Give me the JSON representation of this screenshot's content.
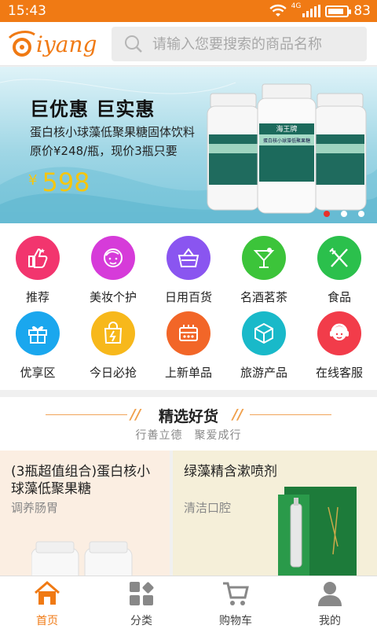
{
  "status_bar": {
    "time": "15:43",
    "battery_percent": "83",
    "battery_level": 0.83,
    "network": "4G"
  },
  "header": {
    "logo_text": "iyang",
    "search_placeholder": "请输入您要搜索的商品名称"
  },
  "banner": {
    "title": "巨优惠 巨实惠",
    "subtitle": "蛋白核小球藻低聚果糖固体饮料",
    "offer": "原价¥248/瓶，现价3瓶只要",
    "currency": "¥",
    "price": "598",
    "bottle_label_top": "海王牌",
    "bottle_label_main": "蛋白核小球藻低聚果糖",
    "slide_count": 3,
    "active_slide": 1
  },
  "categories": [
    {
      "label": "推荐",
      "icon": "thumbs-up-icon",
      "color": "#f2356e"
    },
    {
      "label": "美妆个护",
      "icon": "face-icon",
      "color": "#d63bd9"
    },
    {
      "label": "日用百货",
      "icon": "basket-icon",
      "color": "#8a55f0"
    },
    {
      "label": "名酒茗茶",
      "icon": "cocktail-icon",
      "color": "#3cc43a"
    },
    {
      "label": "食品",
      "icon": "fork-knife-icon",
      "color": "#2bc04c"
    },
    {
      "label": "优享区",
      "icon": "gift-icon",
      "color": "#1aa7ee"
    },
    {
      "label": "今日必抢",
      "icon": "shopping-bag-icon",
      "color": "#f7b81b"
    },
    {
      "label": "上新单品",
      "icon": "stove-icon",
      "color": "#f26628"
    },
    {
      "label": "旅游产品",
      "icon": "cube-icon",
      "color": "#19b9c9"
    },
    {
      "label": "在线客服",
      "icon": "service-agent-icon",
      "color": "#f23c4a"
    }
  ],
  "section": {
    "title": "精选好货",
    "subtitle": "行善立德　聚爱成行"
  },
  "products": [
    {
      "name": "(3瓶超值组合)蛋白核小球藻低聚果糖",
      "desc": "调养肠胃"
    },
    {
      "name": "绿藻精含漱喷剂",
      "desc": "清洁口腔"
    }
  ],
  "tabs": [
    {
      "label": "首页",
      "icon": "home-icon",
      "active": true
    },
    {
      "label": "分类",
      "icon": "category-grid-icon",
      "active": false
    },
    {
      "label": "购物车",
      "icon": "cart-icon",
      "active": false
    },
    {
      "label": "我的",
      "icon": "user-icon",
      "active": false
    }
  ],
  "colors": {
    "brand": "#f07a14",
    "price": "#f5c60f",
    "active_dot": "#e8312b"
  }
}
